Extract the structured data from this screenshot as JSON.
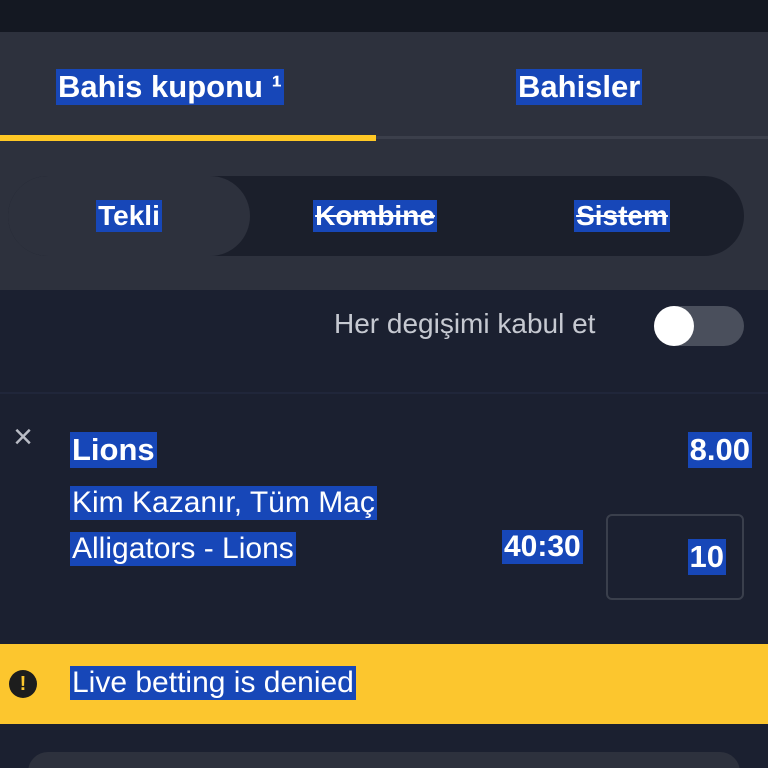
{
  "tabs": [
    {
      "label": "Bahis kuponu ¹",
      "active": true
    },
    {
      "label": "Bahisler",
      "active": false
    }
  ],
  "bet_modes": [
    {
      "label": "Tekli",
      "selected": true,
      "disabled": false
    },
    {
      "label": "Kombine",
      "selected": false,
      "disabled": true
    },
    {
      "label": "Sistem",
      "selected": false,
      "disabled": true
    }
  ],
  "accept_changes": {
    "label": "Her degişimi kabul et",
    "enabled": false
  },
  "bet": {
    "remove_glyph": "×",
    "selection": "Lions",
    "odds": "8.00",
    "market": "Kim Kazanır, Tüm Maç",
    "match": "Alligators - Lions",
    "score": "40:30",
    "stake": "10"
  },
  "alert": {
    "icon": "!",
    "message": "Live betting is denied"
  },
  "colors": {
    "accent": "#ffc825",
    "alert_bg": "#fcc62e",
    "panel_bg": "#2d313d",
    "body_bg": "#1b2030",
    "selection_highlight": "#1747b8"
  }
}
